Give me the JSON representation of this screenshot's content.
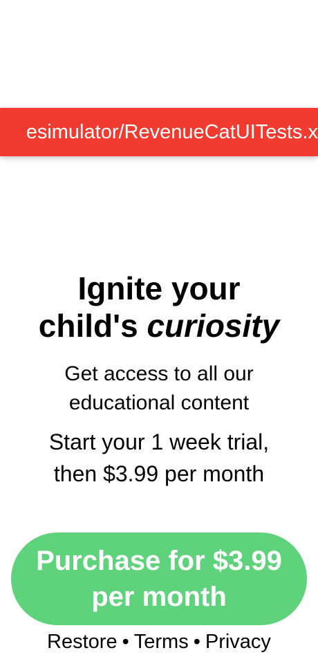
{
  "debug_banner": {
    "text": "esimulator/RevenueCatUITests.x",
    "background_color": "#f13b30"
  },
  "paywall": {
    "title_line1": "Ignite your",
    "title_line2_plain": "child's ",
    "title_line2_italic": "curiosity",
    "subtitle": "Get access to all our educational content",
    "offer": "Start your 1 week trial, then $3.99 per month",
    "cta_label": "Purchase for $3.99 per month",
    "cta_color": "#5fd37c"
  },
  "footer": {
    "restore": "Restore",
    "terms": "Terms",
    "privacy": "Privacy",
    "separator": "•"
  }
}
